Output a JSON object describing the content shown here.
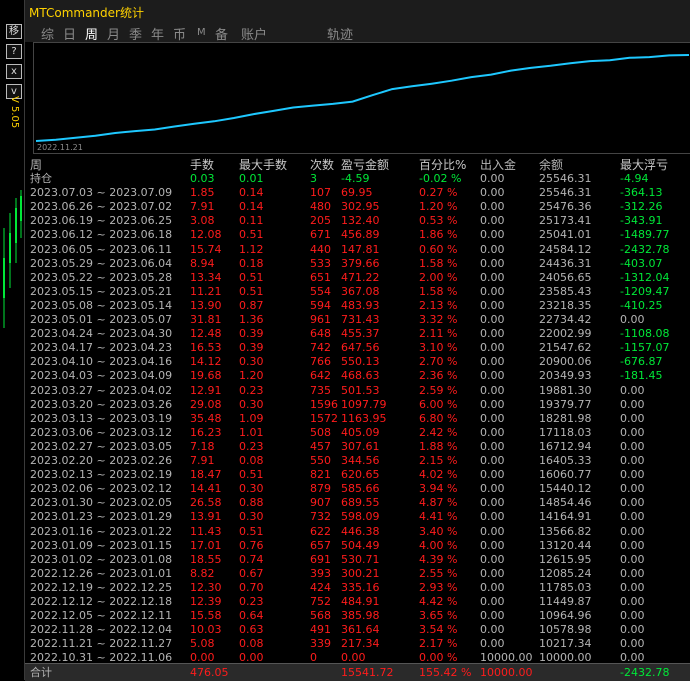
{
  "app": {
    "title": "MTCommander统计",
    "version": "V 5.05"
  },
  "sidebar": {
    "buttons": [
      {
        "name": "move-button",
        "label": "移"
      },
      {
        "name": "help-button",
        "label": "?"
      },
      {
        "name": "minimize-button",
        "label": "x"
      },
      {
        "name": "expand-button",
        "label": "v"
      }
    ]
  },
  "tabs": [
    "综",
    "日",
    "周",
    "月",
    "季",
    "年",
    "币",
    "M",
    "备",
    "账户",
    "轨迹"
  ],
  "active_tab": "周",
  "chart": {
    "start_label": "2022.11.21",
    "line_color": "#1ec8ff",
    "values": [
      10000.0,
      10217.34,
      10578.98,
      10964.96,
      11449.87,
      11785.03,
      12085.24,
      12615.95,
      13120.44,
      13566.82,
      14164.91,
      14854.46,
      15440.12,
      16060.77,
      16405.33,
      16712.94,
      17118.03,
      18281.98,
      19379.77,
      19881.3,
      20349.93,
      20900.06,
      21547.62,
      22002.99,
      22734.42,
      23218.35,
      23585.43,
      24056.65,
      24436.31,
      24584.12,
      25041.01,
      25173.41,
      25476.36,
      25546.31
    ]
  },
  "table": {
    "headers": [
      "周",
      "手数",
      "最大手数",
      "次数",
      "盈亏金额",
      "百分比%",
      "出入金",
      "余额",
      "最大浮亏"
    ],
    "holding": [
      "持仓",
      "0.03",
      "0.01",
      "3",
      "-4.59",
      "-0.02 %",
      "0.00",
      "25546.31",
      "-4.94"
    ],
    "rows": [
      [
        "2023.07.03 ~ 2023.07.09",
        "1.85",
        "0.14",
        "107",
        "69.95",
        "0.27 %",
        "0.00",
        "25546.31",
        "-364.13"
      ],
      [
        "2023.06.26 ~ 2023.07.02",
        "7.91",
        "0.14",
        "480",
        "302.95",
        "1.20 %",
        "0.00",
        "25476.36",
        "-312.26"
      ],
      [
        "2023.06.19 ~ 2023.06.25",
        "3.08",
        "0.11",
        "205",
        "132.40",
        "0.53 %",
        "0.00",
        "25173.41",
        "-343.91"
      ],
      [
        "2023.06.12 ~ 2023.06.18",
        "12.08",
        "0.51",
        "671",
        "456.89",
        "1.86 %",
        "0.00",
        "25041.01",
        "-1489.77"
      ],
      [
        "2023.06.05 ~ 2023.06.11",
        "15.74",
        "1.12",
        "440",
        "147.81",
        "0.60 %",
        "0.00",
        "24584.12",
        "-2432.78"
      ],
      [
        "2023.05.29 ~ 2023.06.04",
        "8.94",
        "0.18",
        "533",
        "379.66",
        "1.58 %",
        "0.00",
        "24436.31",
        "-403.07"
      ],
      [
        "2023.05.22 ~ 2023.05.28",
        "13.34",
        "0.51",
        "651",
        "471.22",
        "2.00 %",
        "0.00",
        "24056.65",
        "-1312.04"
      ],
      [
        "2023.05.15 ~ 2023.05.21",
        "11.21",
        "0.51",
        "554",
        "367.08",
        "1.58 %",
        "0.00",
        "23585.43",
        "-1209.47"
      ],
      [
        "2023.05.08 ~ 2023.05.14",
        "13.90",
        "0.87",
        "594",
        "483.93",
        "2.13 %",
        "0.00",
        "23218.35",
        "-410.25"
      ],
      [
        "2023.05.01 ~ 2023.05.07",
        "31.81",
        "1.36",
        "961",
        "731.43",
        "3.32 %",
        "0.00",
        "22734.42",
        "0.00"
      ],
      [
        "2023.04.24 ~ 2023.04.30",
        "12.48",
        "0.39",
        "648",
        "455.37",
        "2.11 %",
        "0.00",
        "22002.99",
        "-1108.08"
      ],
      [
        "2023.04.17 ~ 2023.04.23",
        "16.53",
        "0.39",
        "742",
        "647.56",
        "3.10 %",
        "0.00",
        "21547.62",
        "-1157.07"
      ],
      [
        "2023.04.10 ~ 2023.04.16",
        "14.12",
        "0.30",
        "766",
        "550.13",
        "2.70 %",
        "0.00",
        "20900.06",
        "-676.87"
      ],
      [
        "2023.04.03 ~ 2023.04.09",
        "19.68",
        "1.20",
        "642",
        "468.63",
        "2.36 %",
        "0.00",
        "20349.93",
        "-181.45"
      ],
      [
        "2023.03.27 ~ 2023.04.02",
        "12.91",
        "0.23",
        "735",
        "501.53",
        "2.59 %",
        "0.00",
        "19881.30",
        "0.00"
      ],
      [
        "2023.03.20 ~ 2023.03.26",
        "29.08",
        "0.30",
        "1596",
        "1097.79",
        "6.00 %",
        "0.00",
        "19379.77",
        "0.00"
      ],
      [
        "2023.03.13 ~ 2023.03.19",
        "35.48",
        "1.09",
        "1572",
        "1163.95",
        "6.80 %",
        "0.00",
        "18281.98",
        "0.00"
      ],
      [
        "2023.03.06 ~ 2023.03.12",
        "16.23",
        "1.01",
        "508",
        "405.09",
        "2.42 %",
        "0.00",
        "17118.03",
        "0.00"
      ],
      [
        "2023.02.27 ~ 2023.03.05",
        "7.18",
        "0.23",
        "457",
        "307.61",
        "1.88 %",
        "0.00",
        "16712.94",
        "0.00"
      ],
      [
        "2023.02.20 ~ 2023.02.26",
        "7.91",
        "0.08",
        "550",
        "344.56",
        "2.15 %",
        "0.00",
        "16405.33",
        "0.00"
      ],
      [
        "2023.02.13 ~ 2023.02.19",
        "18.47",
        "0.51",
        "821",
        "620.65",
        "4.02 %",
        "0.00",
        "16060.77",
        "0.00"
      ],
      [
        "2023.02.06 ~ 2023.02.12",
        "14.41",
        "0.30",
        "879",
        "585.66",
        "3.94 %",
        "0.00",
        "15440.12",
        "0.00"
      ],
      [
        "2023.01.30 ~ 2023.02.05",
        "26.58",
        "0.88",
        "907",
        "689.55",
        "4.87 %",
        "0.00",
        "14854.46",
        "0.00"
      ],
      [
        "2023.01.23 ~ 2023.01.29",
        "13.91",
        "0.30",
        "732",
        "598.09",
        "4.41 %",
        "0.00",
        "14164.91",
        "0.00"
      ],
      [
        "2023.01.16 ~ 2023.01.22",
        "11.43",
        "0.51",
        "622",
        "446.38",
        "3.40 %",
        "0.00",
        "13566.82",
        "0.00"
      ],
      [
        "2023.01.09 ~ 2023.01.15",
        "17.01",
        "0.76",
        "657",
        "504.49",
        "4.00 %",
        "0.00",
        "13120.44",
        "0.00"
      ],
      [
        "2023.01.02 ~ 2023.01.08",
        "18.55",
        "0.74",
        "691",
        "530.71",
        "4.39 %",
        "0.00",
        "12615.95",
        "0.00"
      ],
      [
        "2022.12.26 ~ 2023.01.01",
        "8.82",
        "0.67",
        "393",
        "300.21",
        "2.55 %",
        "0.00",
        "12085.24",
        "0.00"
      ],
      [
        "2022.12.19 ~ 2022.12.25",
        "12.30",
        "0.70",
        "424",
        "335.16",
        "2.93 %",
        "0.00",
        "11785.03",
        "0.00"
      ],
      [
        "2022.12.12 ~ 2022.12.18",
        "12.39",
        "0.23",
        "752",
        "484.91",
        "4.42 %",
        "0.00",
        "11449.87",
        "0.00"
      ],
      [
        "2022.12.05 ~ 2022.12.11",
        "15.58",
        "0.64",
        "568",
        "385.98",
        "3.65 %",
        "0.00",
        "10964.96",
        "0.00"
      ],
      [
        "2022.11.28 ~ 2022.12.04",
        "10.03",
        "0.63",
        "491",
        "361.64",
        "3.54 %",
        "0.00",
        "10578.98",
        "0.00"
      ],
      [
        "2022.11.21 ~ 2022.11.27",
        "5.08",
        "0.08",
        "339",
        "217.34",
        "2.17 %",
        "0.00",
        "10217.34",
        "0.00"
      ],
      [
        "2022.10.31 ~ 2022.11.06",
        "0.00",
        "0.00",
        "0",
        "0.00",
        "0.00 %",
        "10000.00",
        "10000.00",
        "0.00"
      ]
    ],
    "total": [
      "合计",
      "476.05",
      "",
      "",
      "15541.72",
      "155.42 %",
      "10000.00",
      "",
      "-2432.78"
    ]
  },
  "colors": {
    "positive": "#ff1c1c",
    "negative": "#00e838",
    "neutral": "#b4b4b4",
    "accent": "#ffd200"
  }
}
